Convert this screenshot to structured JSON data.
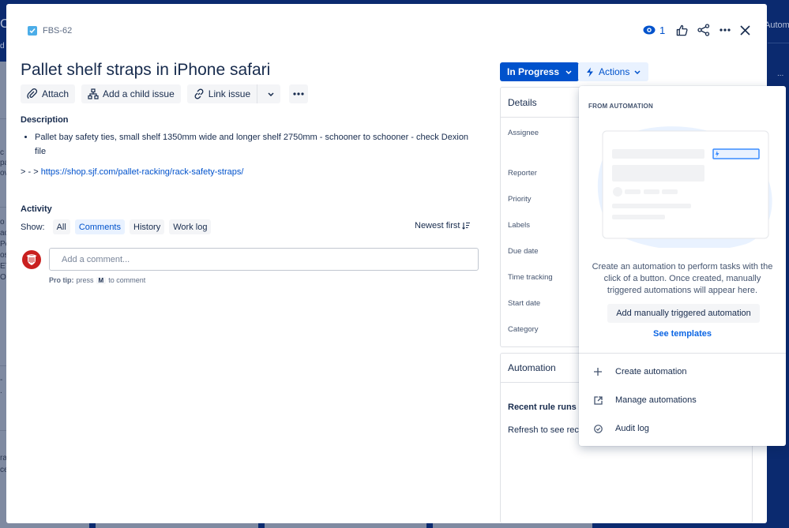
{
  "background": {
    "left_fragments": [
      "C",
      "d",
      "c",
      "pa",
      "ov",
      "o",
      "ac",
      "Po",
      "os",
      "ET",
      "O",
      "-",
      ".",
      "ra",
      "ce"
    ],
    "right_fragment": "Autom",
    "right_dots": "..."
  },
  "issue": {
    "key": "FBS-62",
    "title": "Pallet shelf straps in iPhone safari",
    "watch_count": "1"
  },
  "toolbar": {
    "attach": "Attach",
    "add_child": "Add a child issue",
    "link_issue": "Link issue"
  },
  "description": {
    "label": "Description",
    "bullets": [
      "Pallet bay safety ties, small shelf 1350mm wide and longer shelf 2750mm - schooner to schooner - check Dexion file"
    ],
    "link_prefix": "> - > ",
    "link_text": "https://shop.sjf.com/pallet-racking/rack-safety-straps/"
  },
  "activity": {
    "label": "Activity",
    "show_label": "Show:",
    "filters": [
      {
        "label": "All",
        "active": false
      },
      {
        "label": "Comments",
        "active": true
      },
      {
        "label": "History",
        "active": false
      },
      {
        "label": "Work log",
        "active": false
      }
    ],
    "sort_label": "Newest first",
    "comment_placeholder": "Add a comment...",
    "pro_tip_label": "Pro tip:",
    "pro_tip_press": "press",
    "pro_tip_key": "M",
    "pro_tip_suffix": "to comment"
  },
  "status": {
    "label": "In Progress",
    "color": "#0052cc"
  },
  "actions": {
    "label": "Actions"
  },
  "details": {
    "header": "Details",
    "fields": [
      "Assignee",
      "Reporter",
      "Priority",
      "Labels",
      "Due date",
      "Time tracking",
      "Start date",
      "Category"
    ]
  },
  "automation_panel": {
    "header": "Automation",
    "recent_label": "Recent rule runs",
    "refresh_text": "Refresh to see recent runs"
  },
  "dropdown": {
    "heading": "FROM AUTOMATION",
    "description": "Create an automation to perform tasks with the click of a button. Once created, manually triggered automations will appear here.",
    "add_button": "Add manually triggered automation",
    "templates_link": "See templates",
    "items": [
      {
        "label": "Create automation",
        "icon": "plus-icon"
      },
      {
        "label": "Manage automations",
        "icon": "external-link-icon"
      },
      {
        "label": "Audit log",
        "icon": "check-circle-icon"
      }
    ]
  }
}
